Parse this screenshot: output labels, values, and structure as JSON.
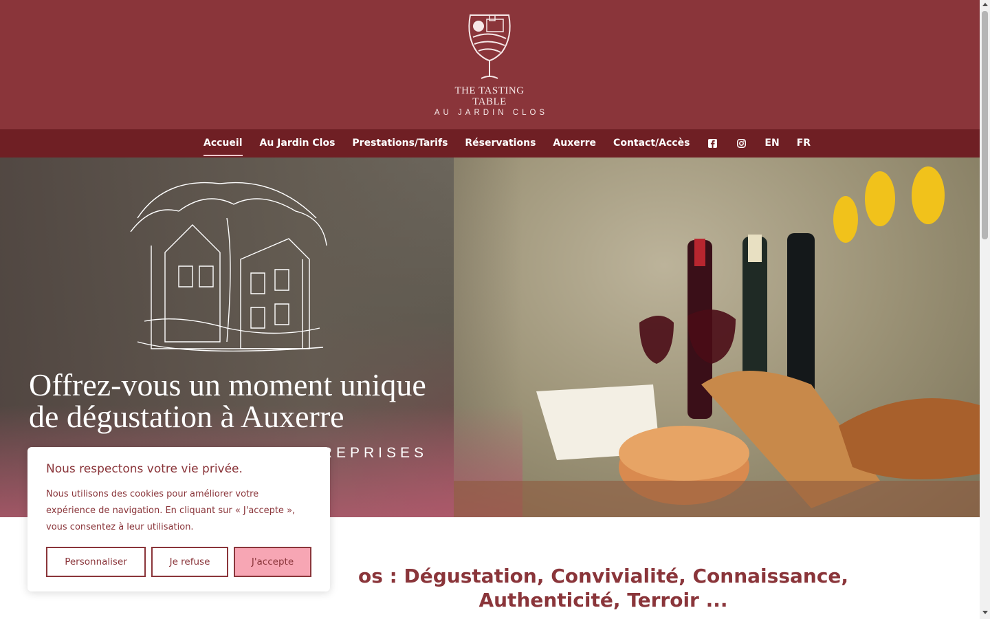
{
  "brand": {
    "line1": "THE TASTING",
    "line2": "TABLE",
    "line3": "AU JARDIN CLOS"
  },
  "nav": {
    "items": [
      {
        "label": "Accueil",
        "active": true
      },
      {
        "label": "Au Jardin Clos"
      },
      {
        "label": "Prestations/Tarifs"
      },
      {
        "label": "Réservations"
      },
      {
        "label": "Auxerre"
      },
      {
        "label": "Contact/Accès"
      }
    ],
    "icons": [
      "facebook-icon",
      "instagram-icon"
    ],
    "languages": [
      "EN",
      "FR"
    ]
  },
  "hero": {
    "title": "Offrez-vous un moment unique de dégustation à Auxerre",
    "subtitle_visible": "TREPRISES"
  },
  "main": {
    "heading_visible": "os : Dégustation, Convivialité, Connaissance, Authenticité, Terroir ..."
  },
  "cookie": {
    "title": "Nous respectons votre vie privée.",
    "text": "Nous utilisons des cookies pour améliorer votre expérience de navigation. En cliquant sur « J'accepte », vous consentez à leur utilisation.",
    "buttons": {
      "customize": "Personnaliser",
      "refuse": "Je refuse",
      "accept": "J'accepte"
    }
  },
  "colors": {
    "brand": "#8a353a",
    "nav": "#6f1f24",
    "accept": "#f7a6b4"
  }
}
